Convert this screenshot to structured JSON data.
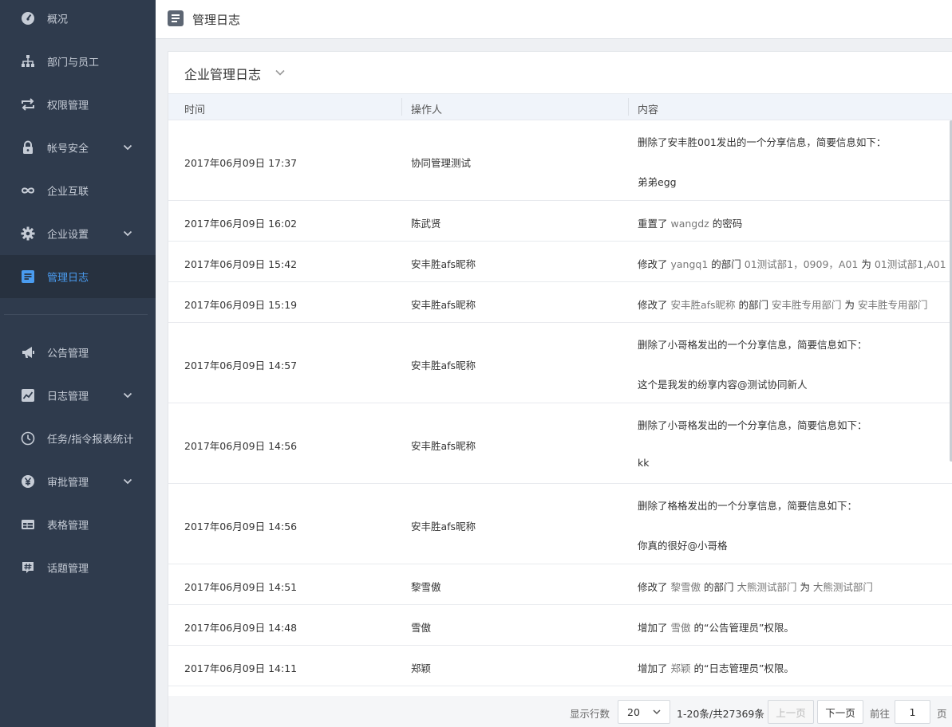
{
  "sidebar": {
    "items": [
      {
        "label": "概况",
        "icon": "dashboard-icon"
      },
      {
        "label": "部门与员工",
        "icon": "org-chart-icon"
      },
      {
        "label": "权限管理",
        "icon": "swap-arrows-icon"
      },
      {
        "label": "帐号安全",
        "icon": "lock-icon",
        "expandable": true
      },
      {
        "label": "企业互联",
        "icon": "infinity-icon"
      },
      {
        "label": "企业设置",
        "icon": "gear-icon",
        "expandable": true
      },
      {
        "label": "管理日志",
        "icon": "document-icon",
        "active": true
      },
      {
        "label": "公告管理",
        "icon": "megaphone-icon"
      },
      {
        "label": "日志管理",
        "icon": "chart-icon",
        "expandable": true
      },
      {
        "label": "任务/指令报表统计",
        "icon": "clock-icon"
      },
      {
        "label": "审批管理",
        "icon": "yen-icon",
        "expandable": true
      },
      {
        "label": "表格管理",
        "icon": "table-icon"
      },
      {
        "label": "话题管理",
        "icon": "hashtag-icon"
      }
    ]
  },
  "header": {
    "title": "管理日志"
  },
  "card": {
    "title": "企业管理日志"
  },
  "table": {
    "columns": [
      "时间",
      "操作人",
      "内容"
    ],
    "rows": [
      {
        "time": "2017年06月09日 17:37",
        "operator": "协同管理测试",
        "content": [
          {
            "t": "删除了安丰胜001发出的一个分享信息，简要信息如下："
          }
        ],
        "detail": "弟弟egg"
      },
      {
        "time": "2017年06月09日 16:02",
        "operator": "陈武贤",
        "content": [
          {
            "t": "重置了 "
          },
          {
            "t": "wangdz",
            "h": true
          },
          {
            "t": " 的密码"
          }
        ]
      },
      {
        "time": "2017年06月09日 15:42",
        "operator": "安丰胜afs昵称",
        "content": [
          {
            "t": "修改了 "
          },
          {
            "t": "yangq1",
            "h": true
          },
          {
            "t": " 的部门 "
          },
          {
            "t": "01测试部1，0909，A01",
            "h": true
          },
          {
            "t": " 为 "
          },
          {
            "t": "01测试部1,A01",
            "h": true
          }
        ]
      },
      {
        "time": "2017年06月09日 15:19",
        "operator": "安丰胜afs昵称",
        "content": [
          {
            "t": "修改了 "
          },
          {
            "t": "安丰胜afs昵称",
            "h": true
          },
          {
            "t": " 的部门 "
          },
          {
            "t": "安丰胜专用部门",
            "h": true
          },
          {
            "t": " 为 "
          },
          {
            "t": "安丰胜专用部门",
            "h": true
          }
        ]
      },
      {
        "time": "2017年06月09日 14:57",
        "operator": "安丰胜afs昵称",
        "content": [
          {
            "t": "删除了小哥格发出的一个分享信息，简要信息如下："
          }
        ],
        "detail": "这个是我发的纷享内容@测试协同新人"
      },
      {
        "time": "2017年06月09日 14:56",
        "operator": "安丰胜afs昵称",
        "content": [
          {
            "t": "删除了小哥格发出的一个分享信息，简要信息如下："
          }
        ],
        "detail": "kk"
      },
      {
        "time": "2017年06月09日 14:56",
        "operator": "安丰胜afs昵称",
        "content": [
          {
            "t": "删除了格格发出的一个分享信息，简要信息如下："
          }
        ],
        "detail": "你真的很好@小哥格"
      },
      {
        "time": "2017年06月09日 14:51",
        "operator": "黎雪傲",
        "content": [
          {
            "t": "修改了 "
          },
          {
            "t": "黎雪傲",
            "h": true
          },
          {
            "t": " 的部门 "
          },
          {
            "t": "大熊测试部门",
            "h": true
          },
          {
            "t": " 为 "
          },
          {
            "t": "大熊测试部门",
            "h": true
          }
        ]
      },
      {
        "time": "2017年06月09日 14:48",
        "operator": "雪傲",
        "content": [
          {
            "t": "增加了 "
          },
          {
            "t": "雪傲",
            "h": true
          },
          {
            "t": " 的“公告管理员”权限。"
          }
        ]
      },
      {
        "time": "2017年06月09日 14:11",
        "operator": "郑颖",
        "content": [
          {
            "t": "增加了 "
          },
          {
            "t": "郑颖",
            "h": true
          },
          {
            "t": " 的“日志管理员”权限。"
          }
        ]
      }
    ]
  },
  "pagination": {
    "rows_label": "显示行数",
    "page_size": "20",
    "range_text": "1-20条/共27369条",
    "prev_label": "上一页",
    "next_label": "下一页",
    "goto_label": "前往",
    "page_value": "1",
    "page_unit": "页"
  },
  "colors": {
    "sidebar_bg": "#2f3b4d",
    "active_text": "#4a9cf0",
    "header_bg": "#f0f4fa"
  }
}
